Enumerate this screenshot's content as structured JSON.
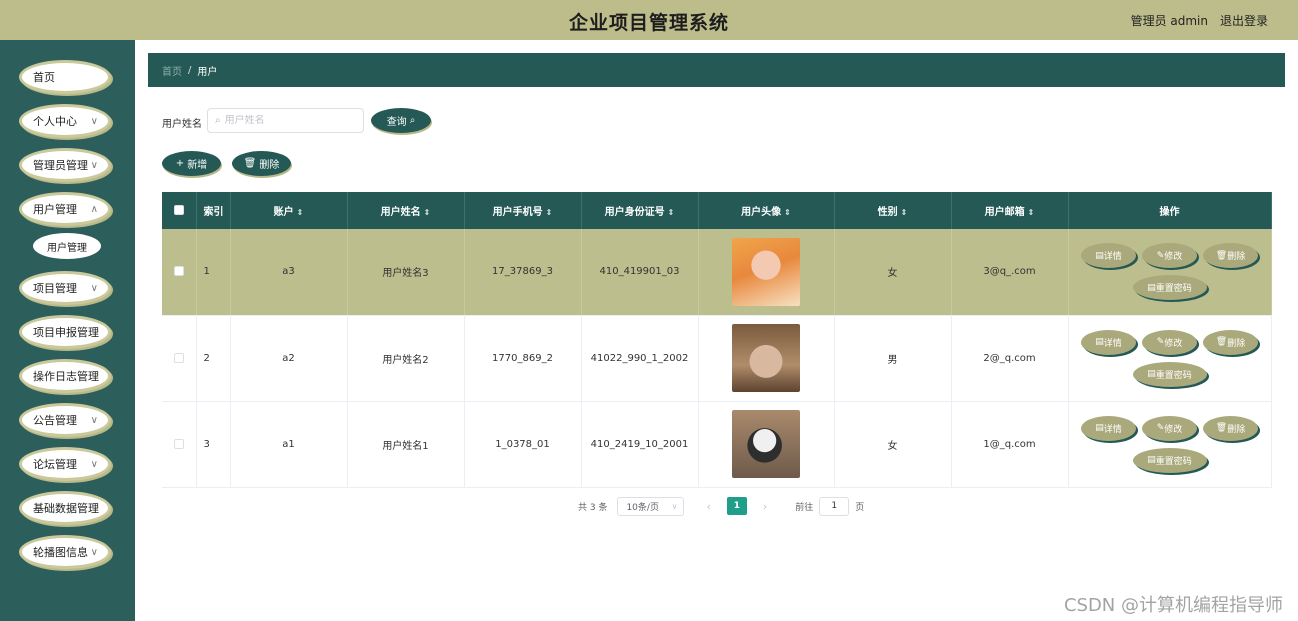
{
  "header": {
    "title": "企业项目管理系统",
    "user": "管理员 admin",
    "logout": "退出登录"
  },
  "sidebar": {
    "items": [
      {
        "label": "首页"
      },
      {
        "label": "个人中心",
        "chevron": "∨"
      },
      {
        "label": "管理员管理",
        "chevron": "∨"
      },
      {
        "label": "用户管理",
        "chevron": "∧"
      },
      {
        "label": "项目管理",
        "chevron": "∨"
      },
      {
        "label": "项目申报管理",
        "chevron": "∨"
      },
      {
        "label": "操作日志管理",
        "chevron": "∨"
      },
      {
        "label": "公告管理",
        "chevron": "∨"
      },
      {
        "label": "论坛管理",
        "chevron": "∨"
      },
      {
        "label": "基础数据管理",
        "chevron": "∨"
      },
      {
        "label": "轮播图信息",
        "chevron": "∨"
      }
    ],
    "subitem": "用户管理"
  },
  "breadcrumb": {
    "home": "首页",
    "separator": "/",
    "current": "用户"
  },
  "search": {
    "label": "用户姓名",
    "placeholder": "用户姓名",
    "value": "",
    "button": "查询"
  },
  "actions": {
    "add": "新增",
    "delete": "删除"
  },
  "table": {
    "columns": [
      "索引",
      "账户",
      "用户姓名",
      "用户手机号",
      "用户身份证号",
      "用户头像",
      "性别",
      "用户邮箱",
      "操作"
    ],
    "rows": [
      {
        "index": "1",
        "account": "a3",
        "name": "用户姓名3",
        "phone": "17_37869_3",
        "idcard": "410_419901_03",
        "avatar": "avatar-girl",
        "gender": "女",
        "email": "3@q_.com",
        "highlighted": true
      },
      {
        "index": "2",
        "account": "a2",
        "name": "用户姓名2",
        "phone": "1770_869_2",
        "idcard": "41022_990_1_2002",
        "avatar": "avatar-cat",
        "gender": "男",
        "email": "2@_q.com",
        "highlighted": false
      },
      {
        "index": "3",
        "account": "a1",
        "name": "用户姓名1",
        "phone": "1_0378_01",
        "idcard": "410_2419_10_2001",
        "avatar": "avatar-cat-2",
        "gender": "女",
        "email": "1@_q.com",
        "highlighted": false
      }
    ],
    "row_actions": {
      "detail": "详情",
      "edit": "修改",
      "delete": "删除",
      "reset": "重置密码"
    }
  },
  "pagination": {
    "total": "共 3 条",
    "page_size": "10条/页",
    "current": "1",
    "goto": "前往",
    "goto_value": "1",
    "page_unit": "页"
  },
  "watermark": "CSDN @计算机编程指导师",
  "colors": {
    "topbar": "#bdbd8c",
    "sidebar": "#2c5f5b",
    "dark_teal": "#245955",
    "row_highlight": "#bcbe8d",
    "action_button": "#a9a97c",
    "pager_active": "#1f9e8a"
  }
}
